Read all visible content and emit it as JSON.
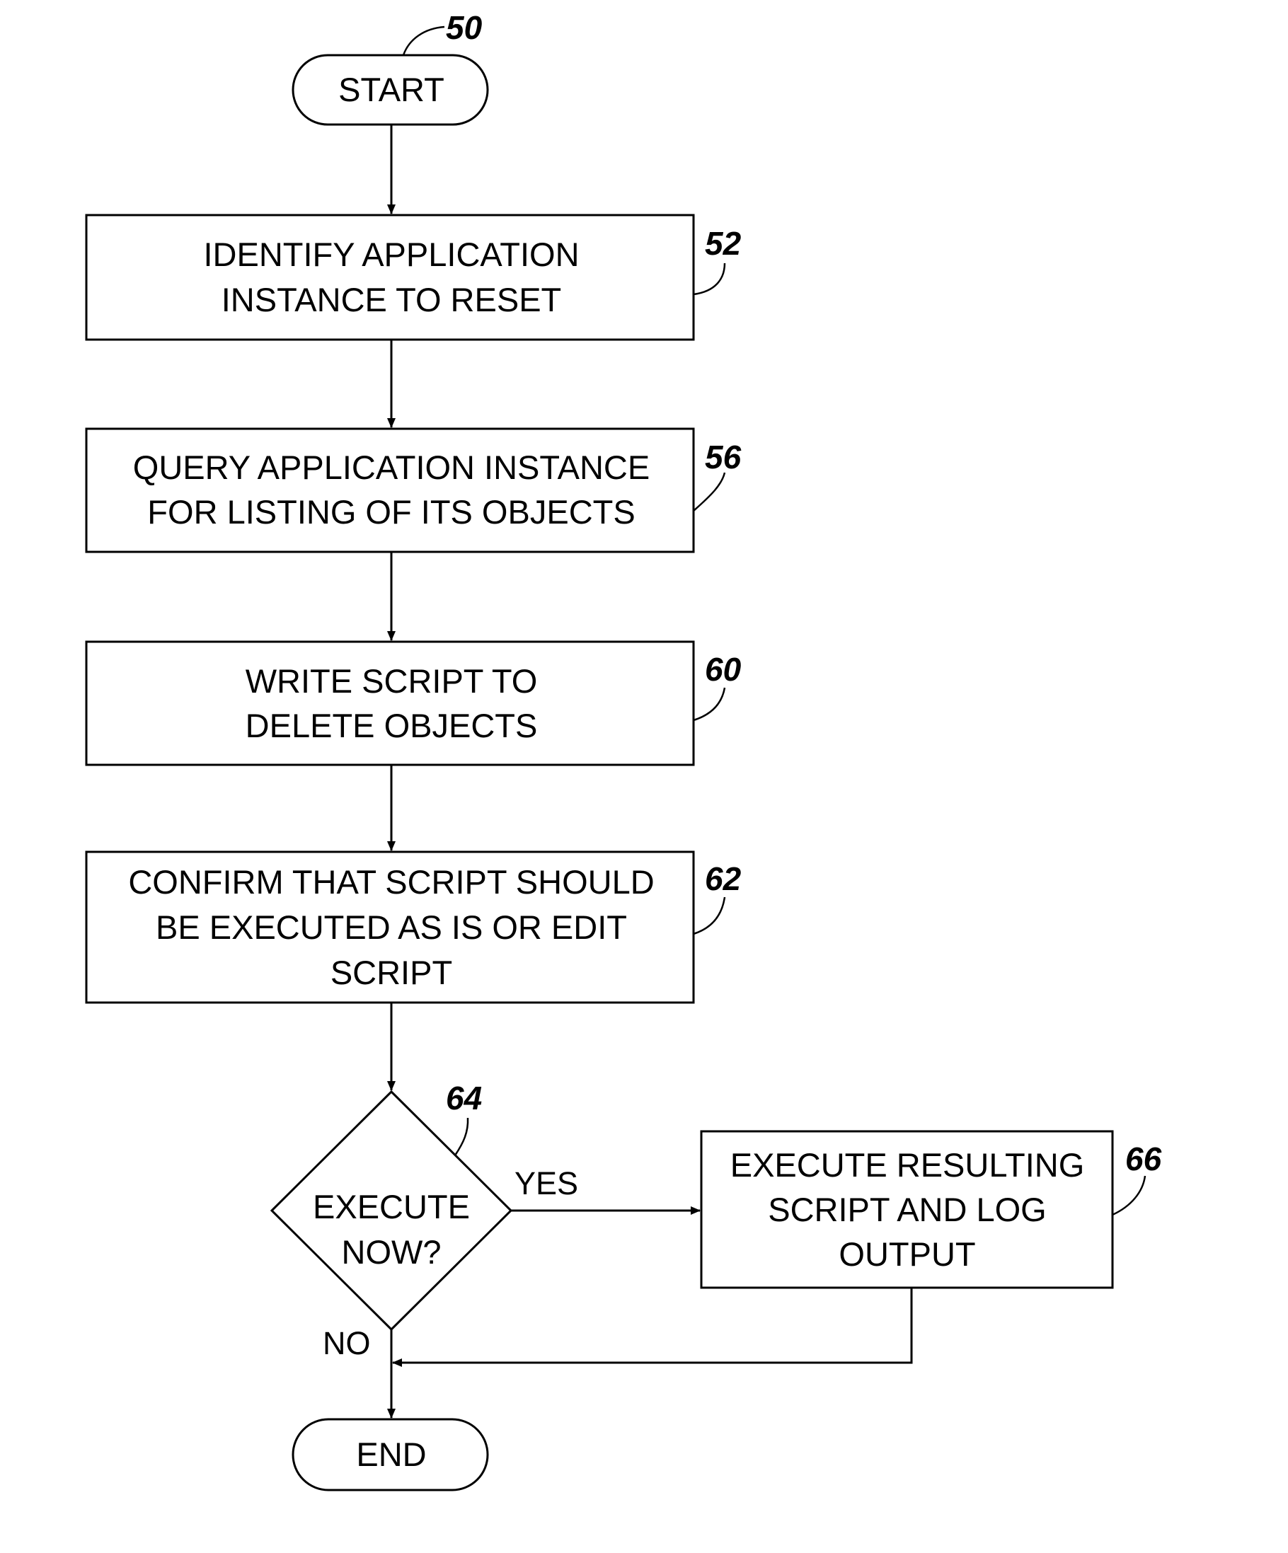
{
  "figure": {
    "type": "flowchart",
    "nodes": [
      {
        "id": "50",
        "kind": "terminator",
        "lines": [
          "START"
        ]
      },
      {
        "id": "52",
        "kind": "process",
        "lines": [
          "IDENTIFY APPLICATION",
          "INSTANCE TO RESET"
        ]
      },
      {
        "id": "56",
        "kind": "process",
        "lines": [
          "QUERY APPLICATION INSTANCE",
          "FOR LISTING OF ITS OBJECTS"
        ]
      },
      {
        "id": "60",
        "kind": "process",
        "lines": [
          "WRITE SCRIPT TO",
          "DELETE OBJECTS"
        ]
      },
      {
        "id": "62",
        "kind": "process",
        "lines": [
          "CONFIRM THAT SCRIPT SHOULD",
          "BE EXECUTED AS IS OR EDIT",
          "SCRIPT"
        ]
      },
      {
        "id": "64",
        "kind": "decision",
        "lines": [
          "EXECUTE",
          "NOW?"
        ]
      },
      {
        "id": "66",
        "kind": "process",
        "lines": [
          "EXECUTE RESULTING",
          "SCRIPT AND LOG",
          "OUTPUT"
        ]
      },
      {
        "id": "end",
        "kind": "terminator",
        "lines": [
          "END"
        ]
      }
    ],
    "edges": [
      {
        "from": "50",
        "to": "52",
        "label": ""
      },
      {
        "from": "52",
        "to": "56",
        "label": ""
      },
      {
        "from": "56",
        "to": "60",
        "label": ""
      },
      {
        "from": "60",
        "to": "62",
        "label": ""
      },
      {
        "from": "62",
        "to": "64",
        "label": ""
      },
      {
        "from": "64",
        "to": "66",
        "label": "YES"
      },
      {
        "from": "64",
        "to": "end",
        "label": "NO"
      },
      {
        "from": "66",
        "to": "end",
        "label": ""
      }
    ],
    "ref_labels": {
      "start": "50",
      "identify": "52",
      "query": "56",
      "write": "60",
      "confirm": "62",
      "decision": "64",
      "execute": "66"
    },
    "branch_labels": {
      "yes": "YES",
      "no": "NO"
    }
  }
}
